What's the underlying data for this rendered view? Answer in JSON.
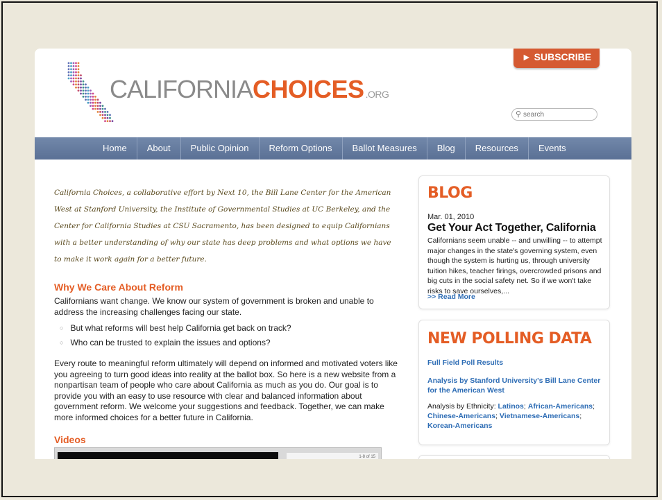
{
  "header": {
    "logo_part1": "CALIFORNIA",
    "logo_part2": "CHOICES",
    "logo_suffix": ".ORG",
    "subscribe_label": "► SUBSCRIBE",
    "search_placeholder": "search"
  },
  "nav": {
    "items": [
      "Home",
      "About",
      "Public Opinion",
      "Reform Options",
      "Ballot Measures",
      "Blog",
      "Resources",
      "Events"
    ]
  },
  "main": {
    "intro": "California Choices, a collaborative effort by Next 10, the Bill Lane Center for the American West at Stanford University, the Institute of Governmental Studies at UC Berkeley, and the Center for California Studies at CSU Sacramento, has been designed to equip Californians with a better understanding of why our state has deep problems and what options we have to make it work again for a better future.",
    "why_heading": "Why We Care About Reform",
    "why_text": "Californians want change. We know our system of government is broken and unable to address the increasing challenges facing our state.",
    "bullets": [
      "But what reforms will best help California get back on track?",
      "Who can be trusted to explain the issues and options?"
    ],
    "body": "Every route to meaningful reform ultimately will depend on informed and motivated voters like you agreeing to turn good ideas into reality at the ballot box. So here is a new website from a nonpartisan team of people who care about California as much as you do. Our goal is to provide you with an easy to use resource with clear and balanced information about government reform. We welcome your suggestions and feedback. Together, we can make more informed choices for a better future in California.",
    "videos_heading": "Videos",
    "video_count": "1-8 of 15"
  },
  "sidebar": {
    "blog": {
      "heading": "BLOG",
      "date": "Mar. 01, 2010",
      "title": "Get Your Act Together, California",
      "excerpt": "Californians seem unable -- and unwilling -- to attempt major changes in the state's governing system, even though the system is hurting us, through university tuition hikes, teacher firings, overcrowded prisons and big cuts in the social safety net. So if we won't take risks to save ourselves,...",
      "read_more": ">> Read More"
    },
    "polling": {
      "heading": "NEW POLLING DATA",
      "link1": "Full Field Poll Results",
      "link2": "Analysis by Stanford University's Bill Lane Center for the American West",
      "ethnicity_label": "Analysis by Ethnicity:",
      "ethnicity_links": [
        "Latinos",
        "African-Americans",
        "Chinese-Americans",
        "Vietnamese-Americans",
        "Korean-Americans"
      ]
    }
  },
  "colors": {
    "accent": "#e45d25",
    "nav": "#637a9f",
    "link": "#2e6db5",
    "background": "#ece8db"
  }
}
